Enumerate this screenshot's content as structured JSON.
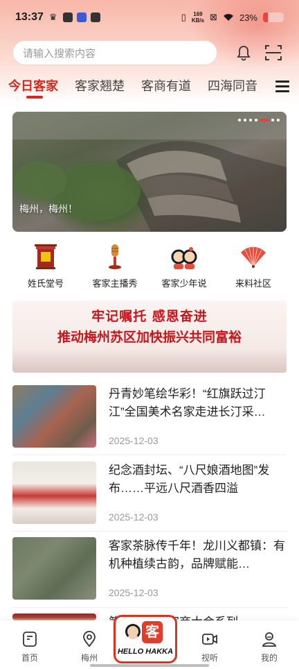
{
  "status_bar": {
    "time": "13:37",
    "speed_value": "169",
    "speed_unit": "KB/s",
    "battery": "23%"
  },
  "search": {
    "placeholder": "请输入搜索内容"
  },
  "tabs": [
    {
      "label": "今日客家",
      "active": true
    },
    {
      "label": "客家翘楚",
      "active": false
    },
    {
      "label": "客商有道",
      "active": false
    },
    {
      "label": "四海同音",
      "active": false
    }
  ],
  "banner": {
    "caption": "梅州，梅州！"
  },
  "quick_links": [
    {
      "label": "姓氏堂号",
      "icon": "ancestral-hall-icon"
    },
    {
      "label": "客家主播秀",
      "icon": "microphone-icon"
    },
    {
      "label": "客家少年说",
      "icon": "children-icon"
    },
    {
      "label": "来料社区",
      "icon": "fan-icon"
    }
  ],
  "promo": {
    "line1": "牢记嘱托  感恩奋进",
    "line2": "推动梅州苏区加快振兴共同富裕"
  },
  "news": [
    {
      "title": "丹青妙笔绘华彩！“红旗跃过汀江”全国美术名家走进长汀采…",
      "date": "2025-12-03"
    },
    {
      "title": "纪念酒封坛、“八尺娘酒地图”发布……平远八尺酒香四溢",
      "date": "2025-12-03"
    },
    {
      "title": "客家茶脉传千年！龙川义都镇：有机种植续古韵，品牌赋能…",
      "date": "2025-12-03"
    },
    {
      "title": "第十届世界客商大会系列",
      "date": ""
    }
  ],
  "bottom_nav": {
    "items": [
      {
        "label": "首页",
        "icon": "home-icon"
      },
      {
        "label": "梅州",
        "icon": "location-pin-icon"
      },
      {
        "label": "视听",
        "icon": "video-icon"
      },
      {
        "label": "我的",
        "icon": "profile-icon"
      }
    ],
    "center": {
      "logo_char": "客",
      "text": "HELLO HAKKA"
    }
  },
  "colors": {
    "accent": "#d7281f",
    "promo_text": "#c8151b",
    "muted_text": "#999999"
  }
}
